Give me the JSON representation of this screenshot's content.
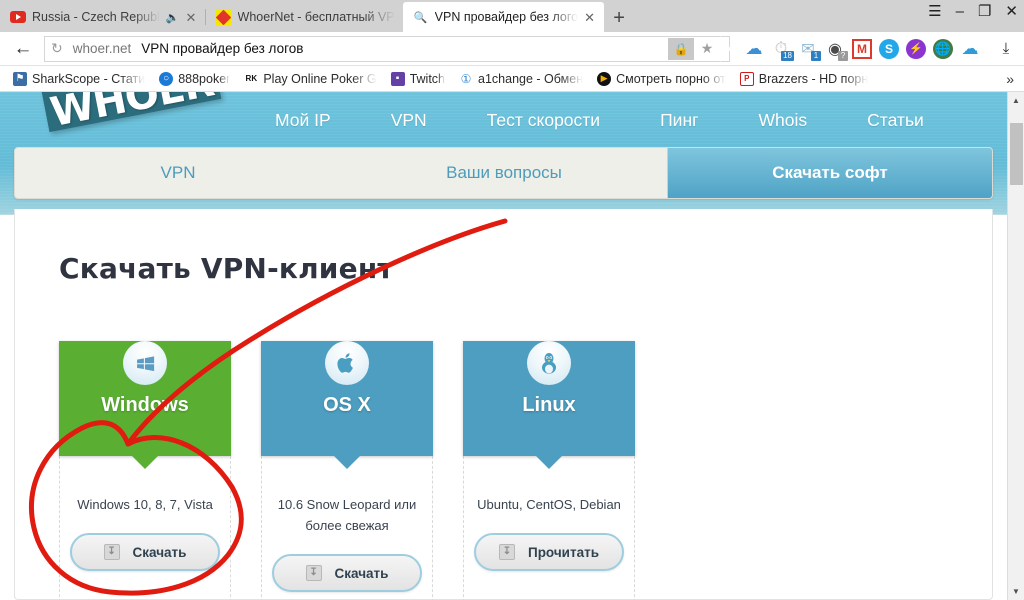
{
  "browser": {
    "tabs": [
      {
        "title": "Russia - Czech Republ",
        "favicon": "youtube-icon",
        "audio": true,
        "active": false
      },
      {
        "title": "WhoerNet - бесплатный VP",
        "favicon": "whoer-icon",
        "audio": false,
        "active": false
      },
      {
        "title": "VPN провайдер без лого",
        "favicon": "search-icon",
        "audio": false,
        "active": true
      }
    ],
    "new_tab_label": "+",
    "window_controls": {
      "menu": "☰",
      "minimize": "–",
      "restore": "❐",
      "close": "✕"
    },
    "toolbar": {
      "back_icon": "←",
      "reload_icon": "↻",
      "url_host": "whoer.net",
      "url_title": "VPN провайдер без логов",
      "lock_icon": "🔒",
      "star_icon": "★",
      "download_icon": "⤓",
      "extensions": [
        {
          "name": "cloud-extension-icon",
          "glyph": "",
          "badge": null,
          "color": "#3a8fd6"
        },
        {
          "name": "clock-extension-icon",
          "glyph": "",
          "badge": "18",
          "color": "#bcbcbc"
        },
        {
          "name": "mail-extension-icon",
          "glyph": "",
          "badge": "1",
          "color": "#8fb8cf"
        },
        {
          "name": "target-extension-icon",
          "glyph": "",
          "badge": "?",
          "color": "#4c4c4c"
        },
        {
          "name": "gmail-extension-icon",
          "glyph": "M",
          "badge": null,
          "color": "#db3a2c"
        },
        {
          "name": "skype-extension-icon",
          "glyph": "S",
          "badge": null,
          "color": "#22a8e8"
        },
        {
          "name": "flash-extension-icon",
          "glyph": "⚡",
          "badge": null,
          "color": "#8b35d1"
        },
        {
          "name": "globe-extension-icon",
          "glyph": "⊕",
          "badge": null,
          "color": "#3f7a47"
        },
        {
          "name": "upload-cloud-extension-icon",
          "glyph": "⇑",
          "badge": null,
          "color": "#2f9bd8"
        }
      ]
    },
    "bookmarks": {
      "items": [
        {
          "label": "SharkScope - Стати",
          "icon_color": "#3a6ea5",
          "glyph": "◉"
        },
        {
          "label": "888poker",
          "icon_color": "#1a7ad6",
          "glyph": "●"
        },
        {
          "label": "Play Online Poker G",
          "icon_color": "#ffffff",
          "glyph": "RK"
        },
        {
          "label": "Twitch",
          "icon_color": "#6441a5",
          "glyph": "⬛"
        },
        {
          "label": "a1change - Обмен",
          "icon_color": "#2f86d0",
          "glyph": "①"
        },
        {
          "label": "Смотреть порно от",
          "icon_color": "#f0b000",
          "glyph": "▶"
        },
        {
          "label": "Brazzers - HD порн",
          "icon_color": "#d01a1a",
          "glyph": "P"
        }
      ],
      "overflow_label": "»"
    }
  },
  "site": {
    "logo_text": "WHOER",
    "nav": [
      {
        "label": "Мой IP"
      },
      {
        "label": "VPN"
      },
      {
        "label": "Тест скорости"
      },
      {
        "label": "Пинг"
      },
      {
        "label": "Whois"
      },
      {
        "label": "Статьи"
      }
    ],
    "tabs": [
      {
        "label": "VPN",
        "active": false
      },
      {
        "label": "Ваши вопросы",
        "active": false
      },
      {
        "label": "Скачать софт",
        "active": true
      }
    ],
    "page_title": "Скачать VPN-клиент",
    "cards": [
      {
        "os": "Windows",
        "icon": "windows-logo-icon",
        "icon_glyph": "⊞",
        "color": "#5aaf33",
        "description": "Windows 10, 8, 7, Vista",
        "button_label": "Скачать",
        "button_icon": "download-icon"
      },
      {
        "os": "OS X",
        "icon": "apple-logo-icon",
        "icon_glyph": "ἴe",
        "color": "#4d9ec0",
        "description": "10.6 Snow Leopard или более свежая",
        "button_label": "Скачать",
        "button_icon": "download-icon"
      },
      {
        "os": "Linux",
        "icon": "linux-penguin-icon",
        "icon_glyph": "🐧",
        "color": "#4d9ec0",
        "description": "Ubuntu, CentOS, Debian",
        "button_label": "Прочитать",
        "button_icon": "download-icon"
      }
    ],
    "colors": {
      "header_blue": "#63bdd8",
      "accent_blue": "#4d9ec0",
      "windows_green": "#5aaf33",
      "annotation_red": "#e01b10"
    }
  },
  "scrollbar": {
    "up_arrow": "▲",
    "down_arrow": "▼"
  }
}
